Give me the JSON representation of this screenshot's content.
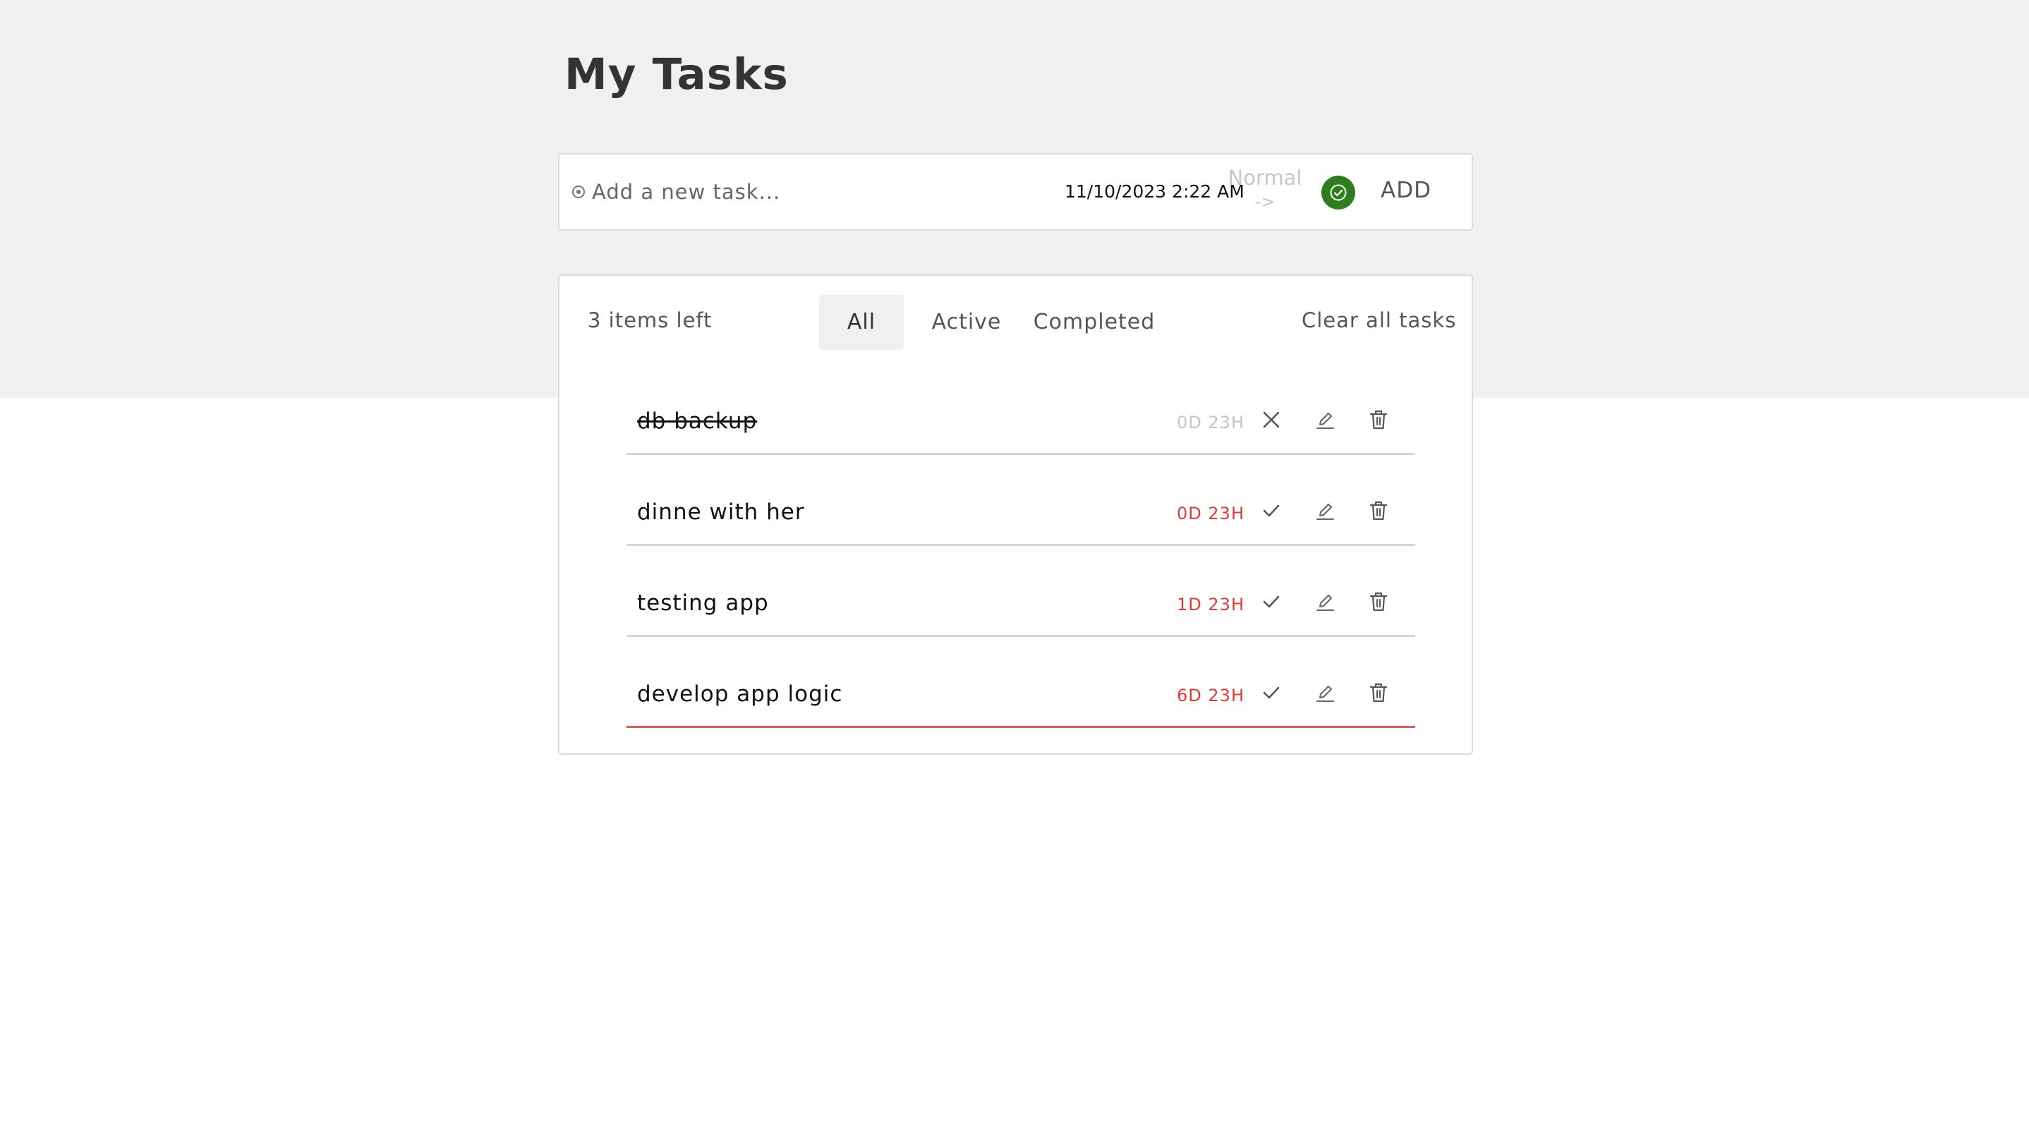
{
  "header": {
    "title": "My Tasks"
  },
  "add_task": {
    "placeholder": "Add a new task...",
    "date": "11/10/2023 2:22 AM",
    "priority_label": "Normal",
    "priority_arrow": "->",
    "confirm_icon": "check-circle-icon",
    "add_label": "ADD",
    "accent_color": "#2e7d1f"
  },
  "list": {
    "items_left": "3 items left",
    "filters": [
      "All",
      "Active",
      "Completed"
    ],
    "selected_filter": "All",
    "clear_label": "Clear all tasks",
    "tasks": [
      {
        "name": "db backup",
        "due": "0D 23H",
        "completed": true
      },
      {
        "name": "dinne with her",
        "due": "0D 23H",
        "completed": false
      },
      {
        "name": "testing app",
        "due": "1D 23H",
        "completed": false
      },
      {
        "name": "develop app logic",
        "due": "6D 23H",
        "completed": false
      }
    ],
    "due_color": "#e53935",
    "urgent_underline_color": "#e85a5a"
  }
}
